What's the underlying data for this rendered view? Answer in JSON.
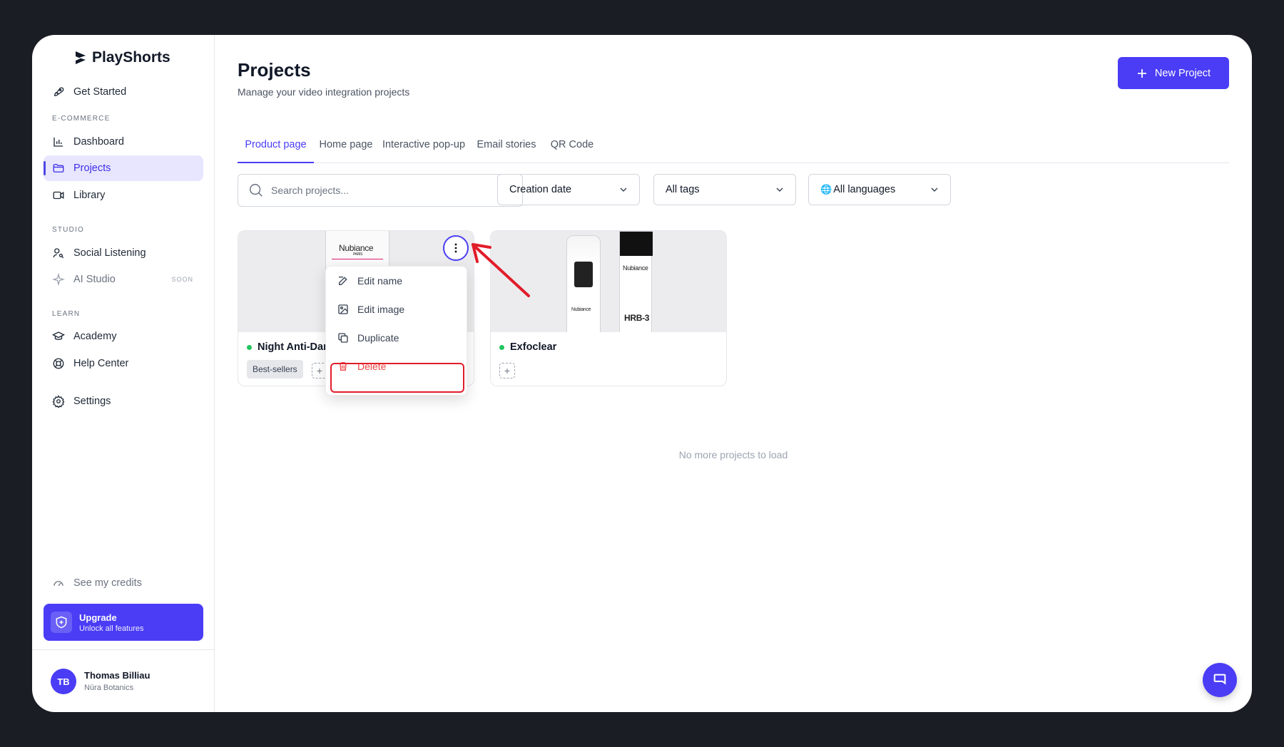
{
  "brand": {
    "name": "PlayShorts"
  },
  "sidebar": {
    "get_started": "Get Started",
    "section_ecommerce": "E-COMMERCE",
    "dashboard": "Dashboard",
    "projects": "Projects",
    "library": "Library",
    "section_studio": "STUDIO",
    "social_listening": "Social Listening",
    "ai_studio": "AI Studio",
    "ai_studio_badge": "SOON",
    "section_learn": "LEARN",
    "academy": "Academy",
    "help_center": "Help Center",
    "settings": "Settings",
    "credits": "See my credits",
    "upgrade_title": "Upgrade",
    "upgrade_sub": "Unlock all features"
  },
  "user": {
    "initials": "TB",
    "name": "Thomas Billiau",
    "org": "Nūra Botanics"
  },
  "header": {
    "title": "Projects",
    "subtitle": "Manage your video integration projects",
    "new_button": "New Project"
  },
  "tabs": [
    "Product page",
    "Home page",
    "Interactive pop-up",
    "Email stories",
    "QR Code"
  ],
  "filters": {
    "search_placeholder": "Search projects...",
    "sort": "Creation date",
    "tags": "All tags",
    "languages": "All languages"
  },
  "projects": [
    {
      "title": "Night Anti-Dark",
      "tag": "Best-sellers",
      "brand_label": "Nubiance",
      "brand_sub": "PARIS"
    },
    {
      "title": "Exfoclear",
      "brand_label": "Nubiance",
      "product_label": "HRB-3"
    }
  ],
  "context_menu": {
    "edit_name": "Edit name",
    "edit_image": "Edit image",
    "duplicate": "Duplicate",
    "delete": "Delete"
  },
  "footer_note": "No more projects to load",
  "colors": {
    "accent": "#4a3df5",
    "danger": "#ef4444",
    "active_dot": "#22c55e",
    "annotation": "#e11d2a"
  }
}
